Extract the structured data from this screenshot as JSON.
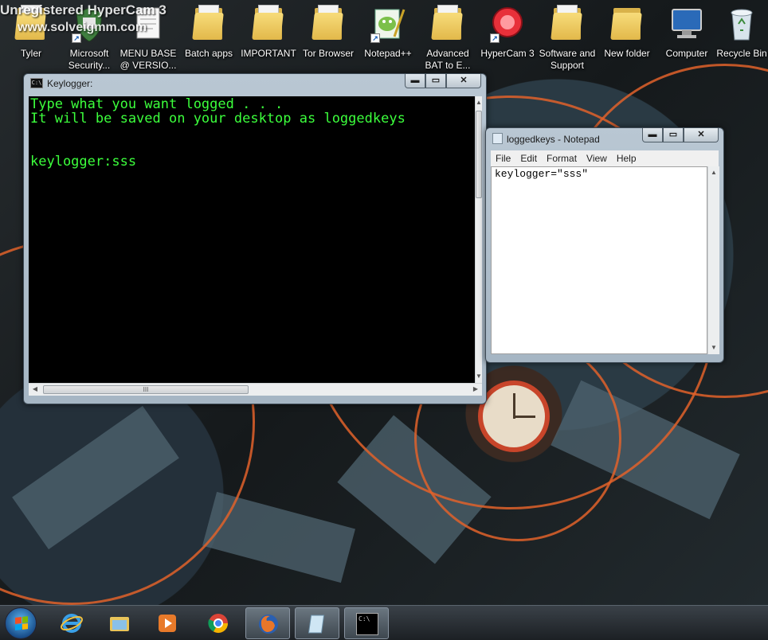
{
  "watermark": {
    "line1": "Unregistered HyperCam 3",
    "line2": "www.solveigmm.com"
  },
  "desktop_icons": [
    {
      "name": "user-folder-icon",
      "label": "Tyler"
    },
    {
      "name": "microsoft-security-icon",
      "label": "Microsoft Security..."
    },
    {
      "name": "text-document-icon",
      "label": "MENU BASE @ VERSIO..."
    },
    {
      "name": "folder-icon",
      "label": "Batch apps"
    },
    {
      "name": "folder-icon",
      "label": "IMPORTANT"
    },
    {
      "name": "tor-browser-icon",
      "label": "Tor Browser"
    },
    {
      "name": "notepad-plus-plus-icon",
      "label": "Notepad++"
    },
    {
      "name": "folder-icon",
      "label": "Advanced BAT to E..."
    },
    {
      "name": "hypercam-icon",
      "label": "HyperCam 3"
    },
    {
      "name": "folder-icon",
      "label": "Software and Support"
    },
    {
      "name": "folder-icon",
      "label": "New folder"
    },
    {
      "name": "computer-icon",
      "label": "Computer"
    },
    {
      "name": "recycle-bin-icon",
      "label": "Recycle Bin"
    }
  ],
  "console_window": {
    "title": "Keylogger:",
    "icon_text": "C:\\",
    "text": "Type what you want logged . . .\nIt will be saved on your desktop as loggedkeys\n\n\nkeylogger:sss",
    "text_color": "#3cff3c",
    "hscroll_grip": "III"
  },
  "notepad_window": {
    "title": "loggedkeys - Notepad",
    "menu": [
      "File",
      "Edit",
      "Format",
      "View",
      "Help"
    ],
    "content": "keylogger=\"sss\""
  },
  "window_controls": {
    "minimize": "▬",
    "maximize": "▭",
    "close": "✕"
  },
  "taskbar": {
    "items": [
      {
        "name": "internet-explorer-icon",
        "active": false
      },
      {
        "name": "file-explorer-icon",
        "active": false
      },
      {
        "name": "media-player-icon",
        "active": false
      },
      {
        "name": "chrome-icon",
        "active": false
      },
      {
        "name": "firefox-icon",
        "active": true
      },
      {
        "name": "notepad-icon",
        "active": true
      },
      {
        "name": "command-prompt-icon",
        "active": true
      }
    ]
  }
}
